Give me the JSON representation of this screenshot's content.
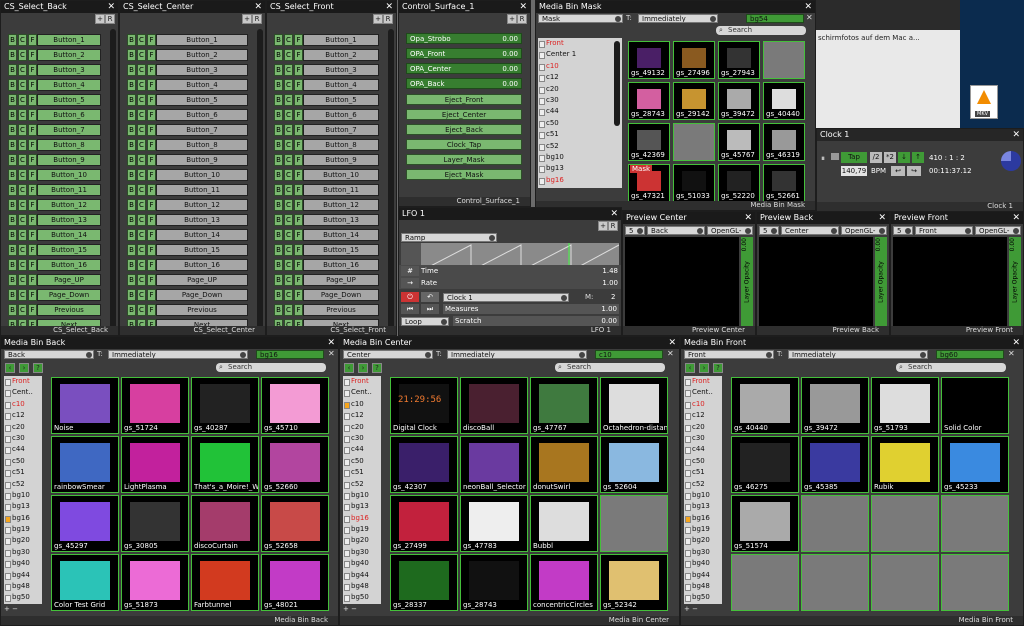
{
  "cs_back": {
    "title": "CS_Select_Back",
    "status": "CS_Select_Back",
    "buttons": [
      "Button_1",
      "Button_2",
      "Button_3",
      "Button_4",
      "Button_5",
      "Button_6",
      "Button_7",
      "Button_8",
      "Button_9",
      "Button_10",
      "Button_11",
      "Button_12",
      "Button_13",
      "Button_14",
      "Button_15",
      "Button_16",
      "Page_UP",
      "Page_Down",
      "Previous",
      "Next"
    ]
  },
  "cs_center": {
    "title": "CS_Select_Center",
    "status": "CS_Select_Center",
    "buttons": [
      "Button_1",
      "Button_2",
      "Button_3",
      "Button_4",
      "Button_5",
      "Button_6",
      "Button_7",
      "Button_8",
      "Button_9",
      "Button_10",
      "Button_11",
      "Button_12",
      "Button_13",
      "Button_14",
      "Button_15",
      "Button_16",
      "Page_UP",
      "Page_Down",
      "Previous",
      "Next"
    ]
  },
  "cs_front": {
    "title": "CS_Select_Front",
    "status": "CS_Select_Front",
    "buttons": [
      "Button_1",
      "Button_2",
      "Button_3",
      "Button_4",
      "Button_5",
      "Button_6",
      "Button_7",
      "Button_8",
      "Button_9",
      "Button_10",
      "Button_11",
      "Button_12",
      "Button_13",
      "Button_14",
      "Button_15",
      "Button_16",
      "Page_UP",
      "Page_Down",
      "Previous",
      "Next"
    ]
  },
  "bcf": [
    "B",
    "C",
    "F"
  ],
  "tool_plus": "+",
  "tool_r": "R",
  "close": "✕",
  "control": {
    "title": "Control_Surface_1",
    "status": "Control_Surface_1",
    "faders": [
      {
        "label": "Opa_Strobo",
        "value": "0.00"
      },
      {
        "label": "OPA_Front",
        "value": "0.00"
      },
      {
        "label": "OPA_Center",
        "value": "0.00"
      },
      {
        "label": "OPA_Back",
        "value": "0.00"
      }
    ],
    "buttons": [
      "Eject_Front",
      "Eject_Center",
      "Eject_Back",
      "Clock_Tap",
      "Layer_Mask",
      "Eject_Mask"
    ]
  },
  "mask": {
    "title": "Media Bin Mask",
    "status": "Media Bin Mask",
    "selector": "Mask",
    "t_label": "T:",
    "timing": "Immediately",
    "bin": "bg54",
    "search": "Search",
    "list": [
      "Front",
      "Center 1",
      "c10",
      "c12",
      "c20",
      "c30",
      "c44",
      "c50",
      "c51",
      "c52",
      "bg10",
      "bg13",
      "bg16"
    ],
    "cells": [
      "gs_49132",
      "gs_27496",
      "gs_27943",
      "",
      "gs_28743",
      "gs_29142",
      "gs_39472",
      "gs_40440",
      "gs_42369",
      "",
      "gs_45767",
      "gs_46319",
      "gs_47321",
      "gs_51033",
      "gs_52220",
      "gs_52661"
    ],
    "mask_tag": "Mask"
  },
  "clock": {
    "title": "Clock 1",
    "status": "Clock 1",
    "tap": "Tap",
    "div2": "/2",
    "mul2": "*2",
    "pos": "410 : 1 : 2",
    "bpm": "140,79",
    "bpm_label": "BPM",
    "time": "00:11:37.12"
  },
  "lfo": {
    "title": "LFO 1",
    "status": "LFO 1",
    "shape": "Ramp",
    "rows": [
      {
        "label": "Time",
        "value": "1.48"
      },
      {
        "label": "Rate",
        "value": "1.00"
      }
    ],
    "clock": "Clock 1",
    "m_label": "M:",
    "m_value": "2",
    "measures_label": "Measures",
    "measures_value": "1.00",
    "loop": "Loop",
    "scratch_label": "Scratch",
    "scratch_value": "0.00"
  },
  "preview_center": {
    "title": "Preview Center",
    "num": "5",
    "layer": "Back",
    "renderer": "OpenGL-",
    "value": "0.00",
    "opacity": "Layer Opacity",
    "status": "Preview Center"
  },
  "preview_back": {
    "title": "Preview Back",
    "num": "5",
    "layer": "Center",
    "renderer": "OpenGL-",
    "value": "0.00",
    "opacity": "Layer Opacity",
    "status": "Preview Back"
  },
  "preview_front": {
    "title": "Preview Front",
    "num": "5",
    "layer": "Front",
    "renderer": "OpenGL-",
    "value": "0.00",
    "opacity": "Layer Opacity",
    "status": "Preview Front"
  },
  "bin_back": {
    "title": "Media Bin Back",
    "status": "Media Bin Back",
    "selector": "Back",
    "t_label": "T:",
    "timing": "Immediately",
    "bin": "bg16",
    "search": "Search",
    "list": [
      "Front",
      "Cent..",
      "c10",
      "c12",
      "c20",
      "c30",
      "c44",
      "c50",
      "c51",
      "c52",
      "bg10",
      "bg13",
      "bg16",
      "bg19",
      "bg20",
      "bg30",
      "bg40",
      "bg44",
      "bg48",
      "bg50"
    ],
    "cells": [
      "Noise",
      "gs_51724",
      "gs_40287",
      "gs_45710",
      "rainbowSmear",
      "LightPlasma",
      "That's_a_Moire!_Wigs",
      "gs_52660",
      "gs_45297",
      "gs_30805",
      "discoCurtain",
      "gs_52658",
      "Color Test Grid",
      "gs_51873",
      "Farbtunnel",
      "gs_48021"
    ]
  },
  "bin_center": {
    "title": "Media Bin Center",
    "status": "Media Bin Center",
    "selector": "Center",
    "t_label": "T:",
    "timing": "Immediately",
    "bin": "c10",
    "search": "Search",
    "list": [
      "Front",
      "Cent..",
      "c10",
      "c12",
      "c20",
      "c30",
      "c44",
      "c50",
      "c51",
      "c52",
      "bg10",
      "bg13",
      "bg16",
      "bg19",
      "bg20",
      "bg30",
      "bg40",
      "bg44",
      "bg48",
      "bg50"
    ],
    "cells": [
      "Digital Clock",
      "discoBall",
      "gs_47767",
      "Octahedron-distan",
      "gs_42307",
      "neonBall_Selector",
      "donutSwirl",
      "gs_52604",
      "gs_27499",
      "gs_47783",
      "Bubbl",
      "",
      "gs_28337",
      "gs_28743",
      "concentricCircles",
      "gs_52342"
    ],
    "clock_text": "21:29:56"
  },
  "bin_front": {
    "title": "Media Bin Front",
    "status": "Media Bin Front",
    "selector": "Front",
    "t_label": "T:",
    "timing": "Immediately",
    "bin": "bg60",
    "search": "Search",
    "list": [
      "Front",
      "Cent..",
      "c10",
      "c12",
      "c20",
      "c30",
      "c44",
      "c50",
      "c51",
      "c52",
      "bg10",
      "bg13",
      "bg16",
      "bg19",
      "bg20",
      "bg30",
      "bg40",
      "bg44",
      "bg48",
      "bg50"
    ],
    "cells": [
      "gs_40440",
      "gs_39472",
      "gs_51793",
      "Solid Color",
      "gs_46275",
      "gs_45385",
      "Rubik",
      "gs_45233",
      "gs_51574",
      "",
      "",
      "",
      "",
      "",
      "",
      ""
    ]
  },
  "desktop": {
    "snippet": "schirmfotos auf dem Mac a...",
    "file": "MKV"
  },
  "colors": {
    "accent": "#44c03a",
    "panel": "#3c3c3c",
    "title": "#1a1a1a"
  }
}
